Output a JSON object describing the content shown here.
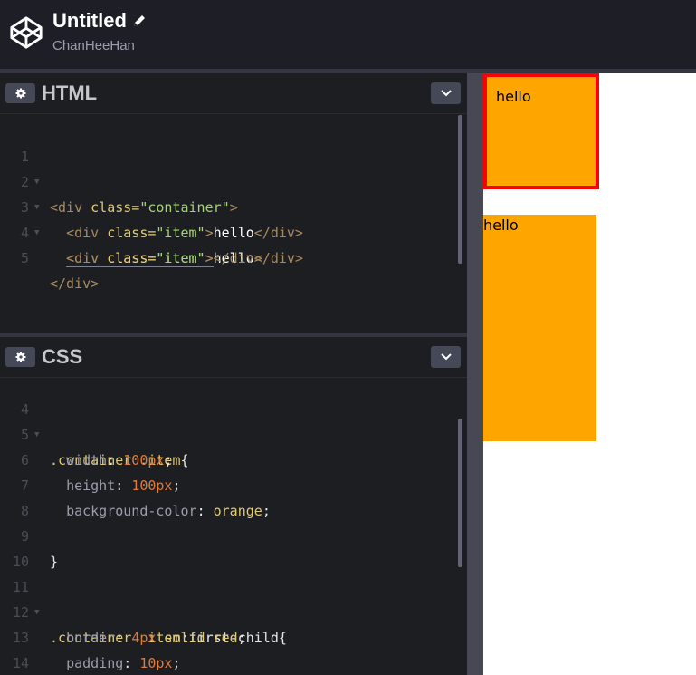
{
  "app": {
    "title": "Untitled",
    "author": "ChanHeeHan"
  },
  "html_panel": {
    "title": "HTML",
    "lines": [
      {
        "n": "1",
        "fold": true
      },
      {
        "n": "2",
        "fold": true
      },
      {
        "n": "3",
        "fold": true
      },
      {
        "n": "4",
        "fold": false
      },
      {
        "n": "5",
        "fold": false
      }
    ],
    "tokens": {
      "l1_open": "<div",
      "l1_attr": "class=",
      "l1_str": "\"container\"",
      "l1_close": ">",
      "l2_open": "<div",
      "l2_attr": "class=",
      "l2_str": "\"item\"",
      "l2_close": ">",
      "l2_text": "hello",
      "l2_end": "</div>",
      "l3_open": "<div",
      "l3_attr": "class=",
      "l3_str": "\"item\"",
      "l3_close": ">",
      "l3_text": "hello",
      "l3_end": "</div>",
      "l4_open": "<div",
      "l4_attr": "class=",
      "l4_str": "\"item\"",
      "l4_close": "></div>",
      "l5_end": "</div>"
    }
  },
  "css_panel": {
    "title": "CSS",
    "lines": [
      {
        "n": "4",
        "fold": true
      },
      {
        "n": "5",
        "fold": false
      },
      {
        "n": "6",
        "fold": false
      },
      {
        "n": "7",
        "fold": false
      },
      {
        "n": "8",
        "fold": false
      },
      {
        "n": "9",
        "fold": false
      },
      {
        "n": "10",
        "fold": false
      },
      {
        "n": "11",
        "fold": true
      },
      {
        "n": "12",
        "fold": false
      },
      {
        "n": "13",
        "fold": false
      },
      {
        "n": "14",
        "fold": false
      }
    ],
    "tokens": {
      "l4_sel": ".container .item",
      "l4_brace": "{",
      "l5_prop": "width",
      "l5_val": "100px",
      "l6_prop": "height",
      "l6_val": "100px",
      "l7_prop": "background-color",
      "l7_val": "orange",
      "l9_brace": "}",
      "l11_sel": ".container .item",
      "l11_pseudo": ":first-child",
      "l11_brace": "{",
      "l12_prop": "border",
      "l12_num": "4px",
      "l12_val": "solid red",
      "l13_prop": "padding",
      "l13_val": "10px",
      "l14_brace": "}",
      "colon": ":",
      "semi": ";"
    }
  },
  "preview": {
    "item1_text": "hello",
    "item2_text": "hello"
  },
  "colors": {
    "header_bg": "#1e1f26",
    "editor_bg": "#1d1e22",
    "accent_orange": "orange",
    "border_red": "#ff0000"
  },
  "icons": {
    "logo": "codepen-logo-icon",
    "edit": "pencil-icon",
    "settings": "gear-icon",
    "collapse": "chevron-down-icon"
  }
}
